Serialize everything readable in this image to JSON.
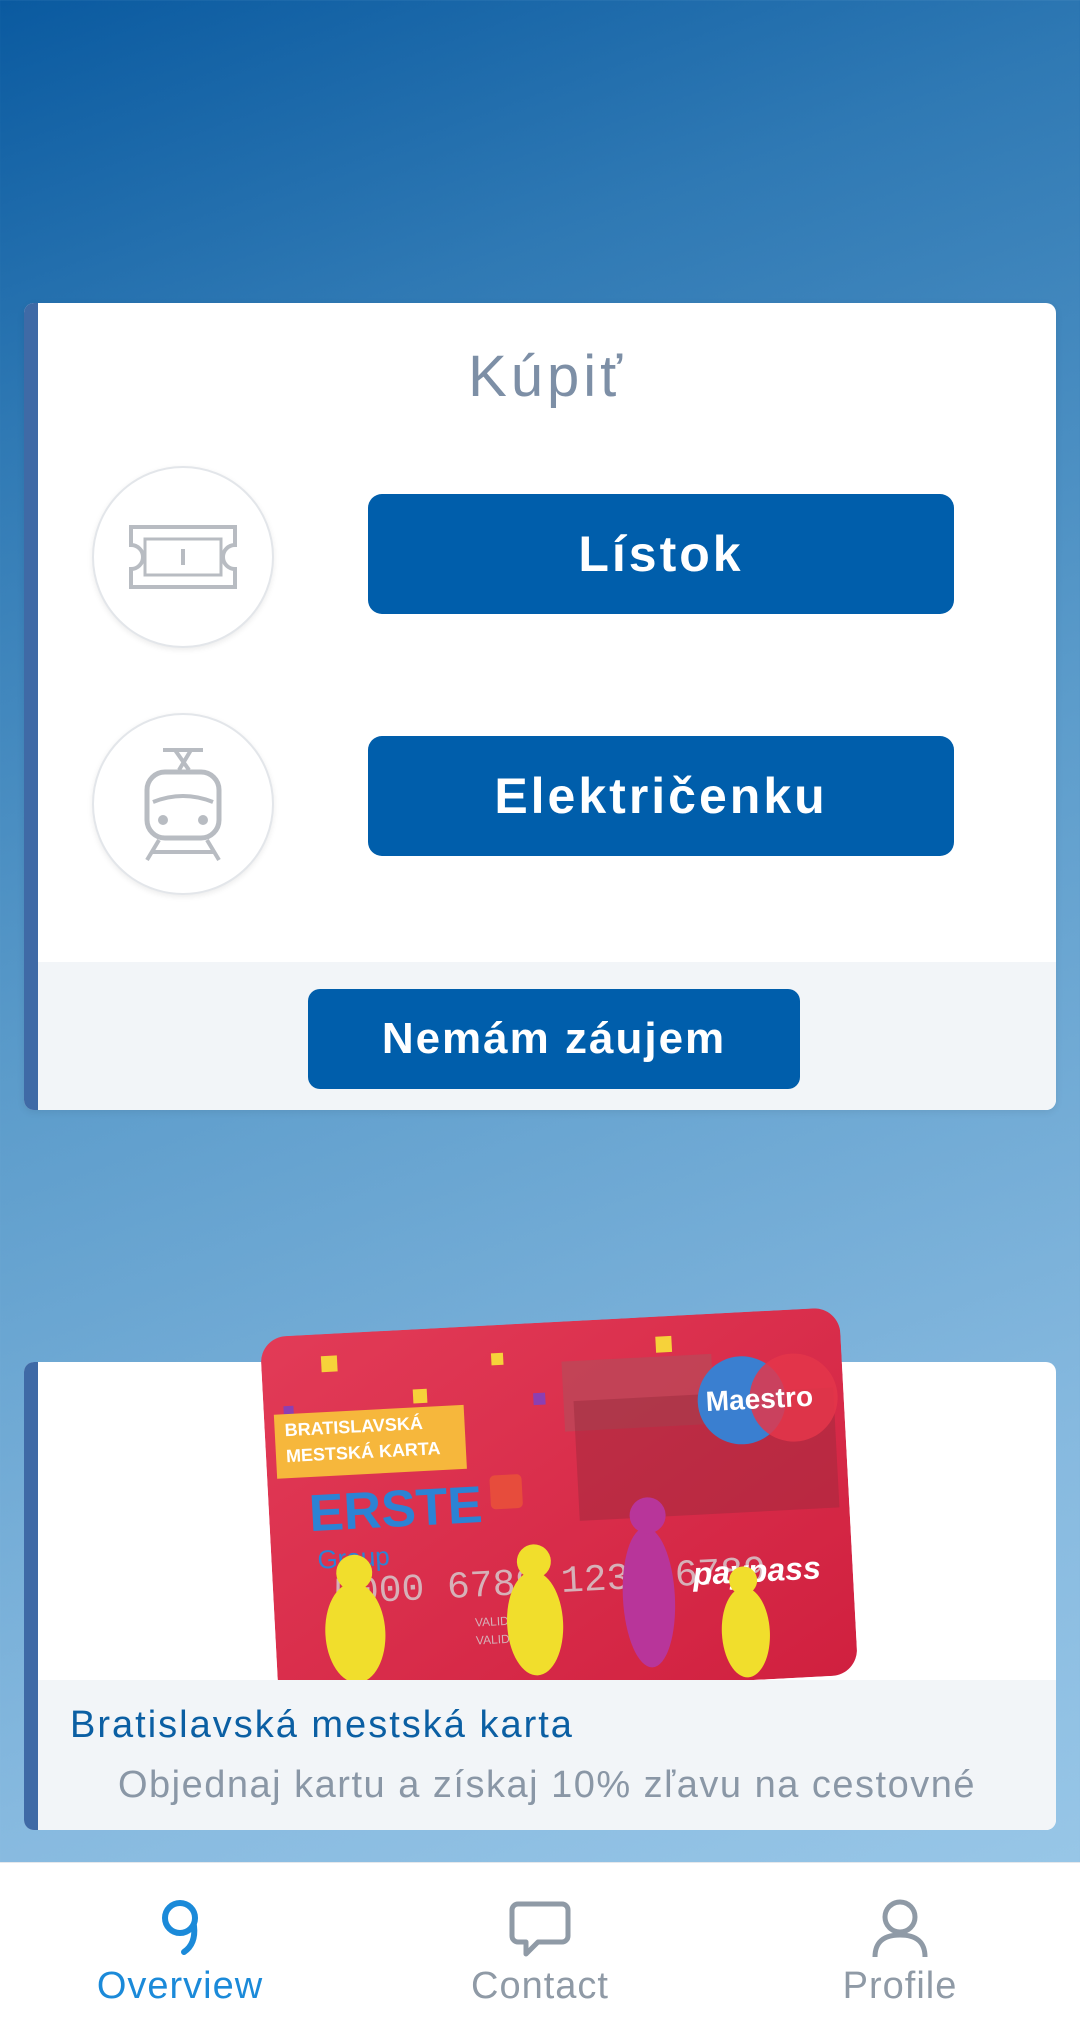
{
  "buy_card": {
    "title": "Kúpiť",
    "options": [
      {
        "label": "Lístok",
        "icon": "ticket-icon"
      },
      {
        "label": "Električenku",
        "icon": "tram-icon"
      }
    ],
    "decline_label": "Nemám záujem"
  },
  "promo_card": {
    "title": "Bratislavská mestská karta",
    "subtitle": "Objednaj kartu a získaj 10% zľavu na cestovné",
    "card_image": {
      "top_label_1": "BRATISLAVSKÁ",
      "top_label_2": "MESTSKÁ KARTA",
      "bank": "ERSTE",
      "bank_sub": "Group",
      "brand": "Maestro",
      "number": "5000 6789 1234 6789",
      "paypass": "paypass",
      "valid_label": "VALID DATES",
      "valid_thru": "VALID THRU"
    }
  },
  "bottom_nav": {
    "items": [
      {
        "label": "Overview",
        "icon": "overview-icon",
        "active": true
      },
      {
        "label": "Contact",
        "icon": "chat-icon",
        "active": false
      },
      {
        "label": "Profile",
        "icon": "profile-icon",
        "active": false
      }
    ]
  },
  "colors": {
    "primary_button": "#005eab",
    "accent_bar": "#3f6aa6",
    "active_nav": "#1b8ad9",
    "inactive_nav": "#8f9aa6"
  }
}
